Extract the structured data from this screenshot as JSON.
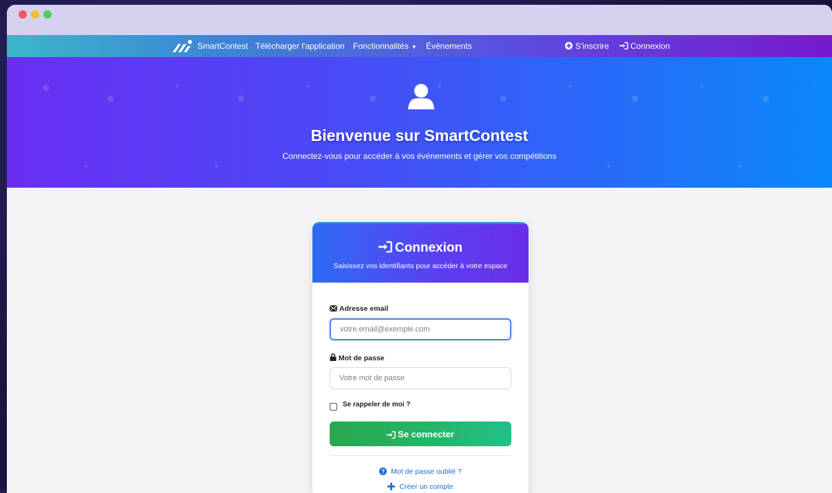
{
  "navbar": {
    "brand": "SmartContest",
    "download_app": "Télécharger l'application",
    "features": "Fonctionnalités",
    "events": "Événements",
    "register": "S'inscrire",
    "login": "Connexion"
  },
  "hero": {
    "title": "Bienvenue sur SmartContest",
    "subtitle": "Connectez-vous pour accéder à vos événements et gérer vos compétitions"
  },
  "login_card": {
    "title": "Connexion",
    "subtitle": "Saisissez vos identifiants pour accéder à votre espace",
    "email_label": "Adresse email",
    "email_placeholder": "votre.email@exemple.com",
    "email_value": "",
    "password_label": "Mot de passe",
    "password_placeholder": "Votre mot de passe",
    "password_value": "",
    "remember_label": "Se rappeler de moi ?",
    "submit_label": "Se connecter",
    "forgot_password": "Mot de passe oublié ?",
    "create_account": "Créer un compte"
  },
  "icons": {
    "user": "user-icon",
    "login": "sign-in-icon",
    "envelope": "envelope-icon",
    "lock": "lock-icon",
    "question": "question-circle-icon",
    "plus": "plus-icon",
    "plus_circle": "plus-circle-icon",
    "caret": "caret-down-icon"
  },
  "colors": {
    "primary_blue": "#1a6fd0",
    "success_green": "#27b56a",
    "hero_purple": "#6a2ef0",
    "hero_blue": "#0a88f8"
  }
}
